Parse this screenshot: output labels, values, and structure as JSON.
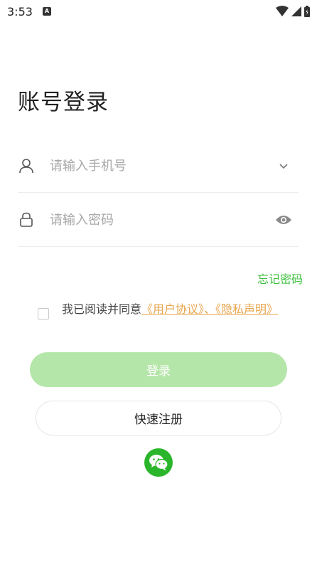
{
  "status_bar": {
    "time": "3:53",
    "app_icon_letter": "A",
    "icons": [
      "wifi-icon",
      "signal-icon",
      "battery-icon"
    ]
  },
  "title": "账号登录",
  "phone_field": {
    "placeholder": "请输入手机号",
    "value": "",
    "icon": "user-icon",
    "trailing_icon": "chevron-down-icon"
  },
  "password_field": {
    "placeholder": "请输入密码",
    "value": "",
    "icon": "lock-icon",
    "trailing_icon": "eye-icon"
  },
  "forgot_password": "忘记密码",
  "agreement": {
    "checked": false,
    "prefix": "我已阅读并同意",
    "user_agreement": "《用户协议》",
    "separator": "、",
    "privacy_policy": "《隐私声明》"
  },
  "login_button": "登录",
  "register_button": "快速注册",
  "wechat_login_icon": "wechat-icon",
  "colors": {
    "accent_green": "#3cbf3c",
    "login_button_bg": "#b5e6a9",
    "link_orange": "#e8a54d",
    "wechat_green": "#2bb52b"
  }
}
